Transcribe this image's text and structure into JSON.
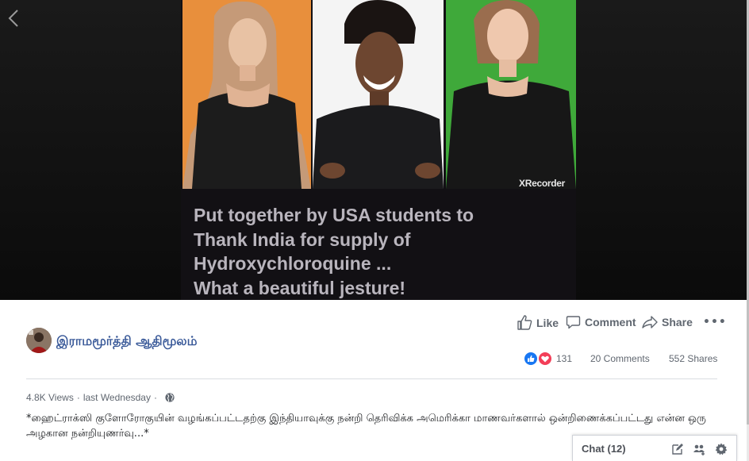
{
  "video": {
    "watermark": "XRecorder",
    "caption_lines": [
      "Put together by USA students to",
      "Thank India for supply of",
      "Hydroxychloroquine ...",
      "What a beautiful jesture!"
    ]
  },
  "post": {
    "author_name": "இராமமூர்த்தி ஆதிமூலம்",
    "actions": {
      "like_label": "Like",
      "comment_label": "Comment",
      "share_label": "Share"
    },
    "reaction_count": "131",
    "comments_count": "20 Comments",
    "shares_count": "552 Shares",
    "views": "4.8K Views",
    "separator": "·",
    "posted_time": "last Wednesday",
    "description": "*ஹைட்ராக்ஸி குளோரோகுயின் வழங்கப்பட்டதற்கு இந்தியாவுக்கு நன்றி தெரிவிக்க அமெரிக்கா மாணவர்களால் ஒன்றிணைக்கப்பட்டது என்ன ஒரு அழகான நன்றியுணர்வு...*"
  },
  "chat": {
    "label": "Chat (12)"
  },
  "colors": {
    "link_blue": "#385898",
    "like_blue": "#1877f2",
    "love_red": "#f33e58",
    "action_grey": "#606770"
  },
  "icons": [
    "back-chevron-icon",
    "like-icon",
    "comment-icon",
    "share-icon",
    "more-icon",
    "globe-icon",
    "compose-icon",
    "group-icon",
    "settings-icon"
  ]
}
